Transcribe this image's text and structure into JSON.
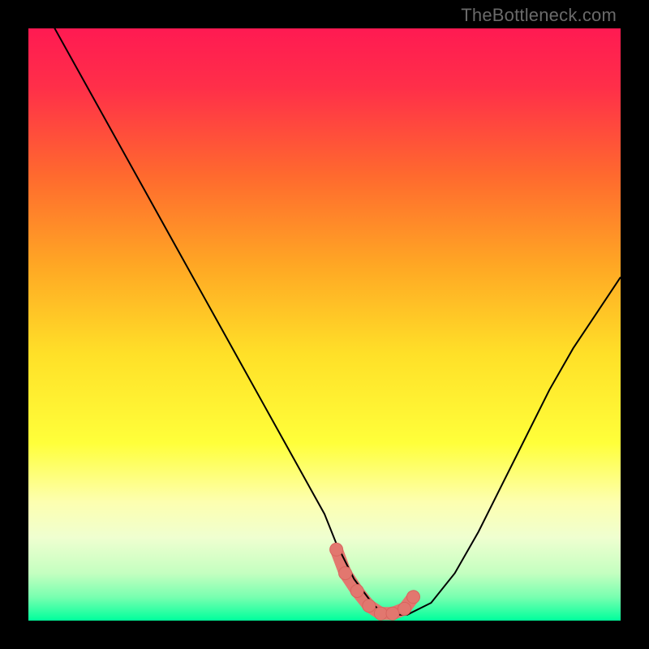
{
  "watermark": "TheBottleneck.com",
  "colors": {
    "frame": "#000000",
    "gradient_stops": [
      {
        "offset": 0.0,
        "color": "#ff1a52"
      },
      {
        "offset": 0.1,
        "color": "#ff2f49"
      },
      {
        "offset": 0.25,
        "color": "#ff6a2e"
      },
      {
        "offset": 0.4,
        "color": "#ffa724"
      },
      {
        "offset": 0.55,
        "color": "#ffe028"
      },
      {
        "offset": 0.7,
        "color": "#ffff3a"
      },
      {
        "offset": 0.8,
        "color": "#fdffb0"
      },
      {
        "offset": 0.86,
        "color": "#efffd0"
      },
      {
        "offset": 0.92,
        "color": "#c4ffc0"
      },
      {
        "offset": 0.96,
        "color": "#79ffb0"
      },
      {
        "offset": 1.0,
        "color": "#00ff9c"
      }
    ],
    "curve": "#000000",
    "marker_fill": "#e2776f",
    "marker_stroke": "#d8645e"
  },
  "chart_data": {
    "type": "line",
    "title": "",
    "xlabel": "",
    "ylabel": "",
    "xlim": [
      0,
      100
    ],
    "ylim": [
      0,
      100
    ],
    "series": [
      {
        "name": "bottleneck-curve",
        "x": [
          0,
          5,
          10,
          15,
          20,
          25,
          30,
          35,
          40,
          45,
          50,
          52,
          55,
          58,
          60,
          62,
          64,
          68,
          72,
          76,
          80,
          84,
          88,
          92,
          96,
          100
        ],
        "y": [
          108,
          99,
          90,
          81,
          72,
          63,
          54,
          45,
          36,
          27,
          18,
          13,
          7,
          3,
          1,
          1,
          1,
          3,
          8,
          15,
          23,
          31,
          39,
          46,
          52,
          58
        ]
      }
    ],
    "markers": {
      "name": "optimal-segment",
      "x": [
        52.0,
        53.5,
        55.5,
        57.5,
        59.5,
        61.5,
        63.5,
        65.0
      ],
      "y": [
        12.0,
        8.0,
        5.0,
        2.5,
        1.2,
        1.2,
        2.0,
        4.0
      ],
      "radius_px": 8
    }
  }
}
